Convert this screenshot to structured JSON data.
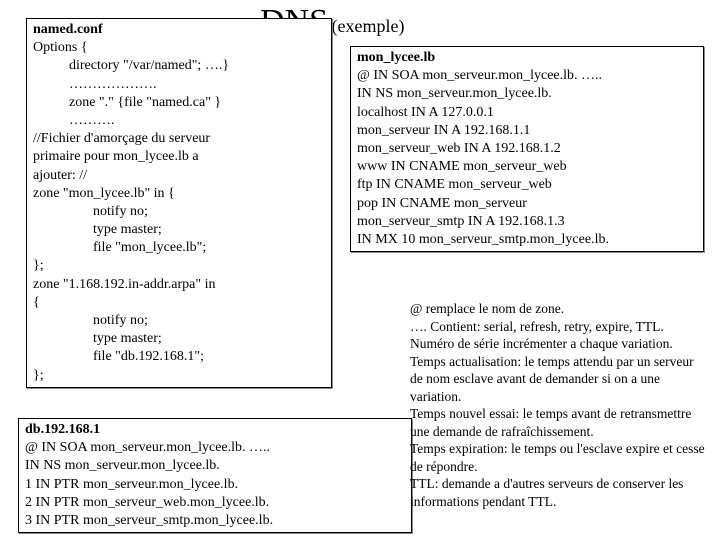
{
  "title": {
    "big": "DNS",
    "small": "(exemple)"
  },
  "named": {
    "heading": "named.conf",
    "l1": "Options {",
    "l2": "directory \"/var/named\"; ….}",
    "l3": "……………….",
    "l4": "zone \".\" {file \"named.ca\" }",
    "l5": "……….",
    "l6": "//Fichier d'amorçage du serveur",
    "l7": "primaire pour mon_lycee.lb a",
    "l8": "ajouter: //",
    "l9": "zone \"mon_lycee.lb\" in {",
    "l10": "notify no;",
    "l11": "type master;",
    "l12": "file \"mon_lycee.lb\";",
    "l13": "};",
    "l14": "zone \"1.168.192.in-addr.arpa\" in",
    "l15": "{",
    "l16": "notify no;",
    "l17": "type master;",
    "l18": "file \"db.192.168.1\";",
    "l19": "};"
  },
  "zone": {
    "heading": "mon_lycee.lb",
    "l1": "@     IN   SOA mon_serveur.mon_lycee.lb. …..",
    "l2": "IN NS   mon_serveur.mon_lycee.lb.",
    "l3": "localhost                         IN A       127.0.0.1",
    "l4": "mon_serveur                    IN A       192.168.1.1",
    "l5": "mon_serveur_web             IN A       192.168.1.2",
    "l6": "www                  IN CNAME        mon_serveur_web",
    "l7": "ftp                      IN CNAME         mon_serveur_web",
    "l8": "pop                    IN CNAME        mon_serveur",
    "l9": "mon_serveur_smtp            IN A       192.168.1.3",
    "l10": "IN MX       10 mon_serveur_smtp.mon_lycee.lb."
  },
  "db": {
    "heading": "db.192.168.1",
    "l1": "@      IN   SOA mon_serveur.mon_lycee.lb. …..",
    "l2": "IN NS   mon_serveur.mon_lycee.lb.",
    "l3": "1        IN PTR    mon_serveur.mon_lycee.lb.",
    "l4": "2        IN PTR    mon_serveur_web.mon_lycee.lb.",
    "l5": "3        IN PTR    mon_serveur_smtp.mon_lycee.lb."
  },
  "notes": {
    "l1": "@ remplace le nom de zone.",
    "l2": "…. Contient: serial, refresh, retry, expire, TTL.",
    "l3": "Numéro de série incrémenter a chaque variation.",
    "l4": "Temps actualisation: le temps attendu par un serveur de nom esclave avant de demander si on a une variation.",
    "l5": "Temps nouvel essai: le temps avant de retransmettre une demande de rafraîchissement.",
    "l6": "Temps expiration: le temps ou l'esclave expire et cesse de répondre.",
    "l7": "TTL: demande a d'autres serveurs de conserver les informations pendant TTL."
  }
}
